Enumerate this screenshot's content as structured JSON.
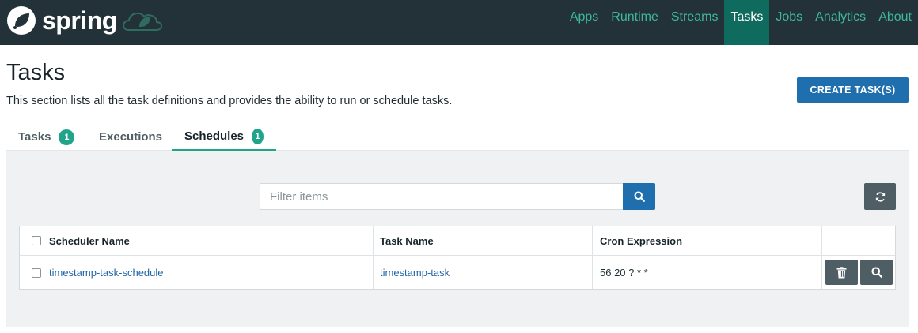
{
  "header": {
    "logo_text": "spring",
    "nav": [
      {
        "label": "Apps",
        "active": false
      },
      {
        "label": "Runtime",
        "active": false
      },
      {
        "label": "Streams",
        "active": false
      },
      {
        "label": "Tasks",
        "active": true
      },
      {
        "label": "Jobs",
        "active": false
      },
      {
        "label": "Analytics",
        "active": false
      },
      {
        "label": "About",
        "active": false
      }
    ]
  },
  "page": {
    "title": "Tasks",
    "description": "This section lists all the task definitions and provides the ability to run or schedule tasks.",
    "create_button": "CREATE TASK(S)"
  },
  "tabs": [
    {
      "label": "Tasks",
      "badge": "1",
      "active": false
    },
    {
      "label": "Executions",
      "badge": "",
      "active": false
    },
    {
      "label": "Schedules",
      "badge": "1",
      "active": true
    }
  ],
  "filter": {
    "placeholder": "Filter items",
    "value": ""
  },
  "table": {
    "columns": [
      "Scheduler Name",
      "Task Name",
      "Cron Expression",
      ""
    ],
    "rows": [
      {
        "scheduler_name": "timestamp-task-schedule",
        "task_name": "timestamp-task",
        "cron_expression": "56 20 ? * *"
      }
    ]
  },
  "icons": {
    "logo": "spring-leaf-icon",
    "filter_search": "search-icon",
    "refresh": "refresh-icon",
    "row_delete": "trash-icon",
    "row_details": "search-icon"
  },
  "colors": {
    "header_bg": "#233238",
    "nav_text": "#3fb89a",
    "nav_active_bg": "#0f6b5d",
    "primary_button": "#1f6eae",
    "secondary_button": "#4f5e64",
    "badge": "#20a48c",
    "link": "#2266a6"
  }
}
